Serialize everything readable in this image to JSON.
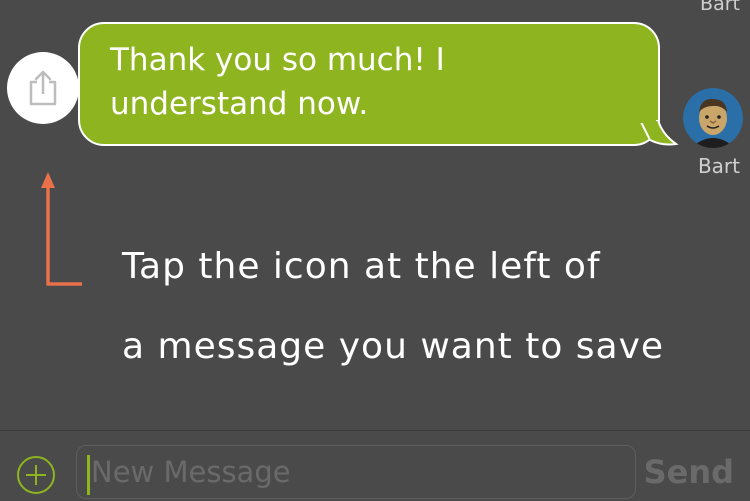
{
  "chat": {
    "previous_sender_name": "Bart",
    "message": {
      "text": "Thank you so much! I understand now.",
      "sender_name": "Bart"
    },
    "share_icon": "share-icon",
    "avatar_icon": "avatar"
  },
  "hint": {
    "line1": "Tap the icon at the left of",
    "line2": "a message you want to save",
    "arrow_icon": "arrow-up-icon"
  },
  "input_bar": {
    "add_icon": "plus-circle-icon",
    "placeholder": "New Message",
    "send_label": "Send"
  },
  "colors": {
    "bubble": "#8eb520",
    "background": "#4a4a4a",
    "arrow": "#e8704a"
  }
}
